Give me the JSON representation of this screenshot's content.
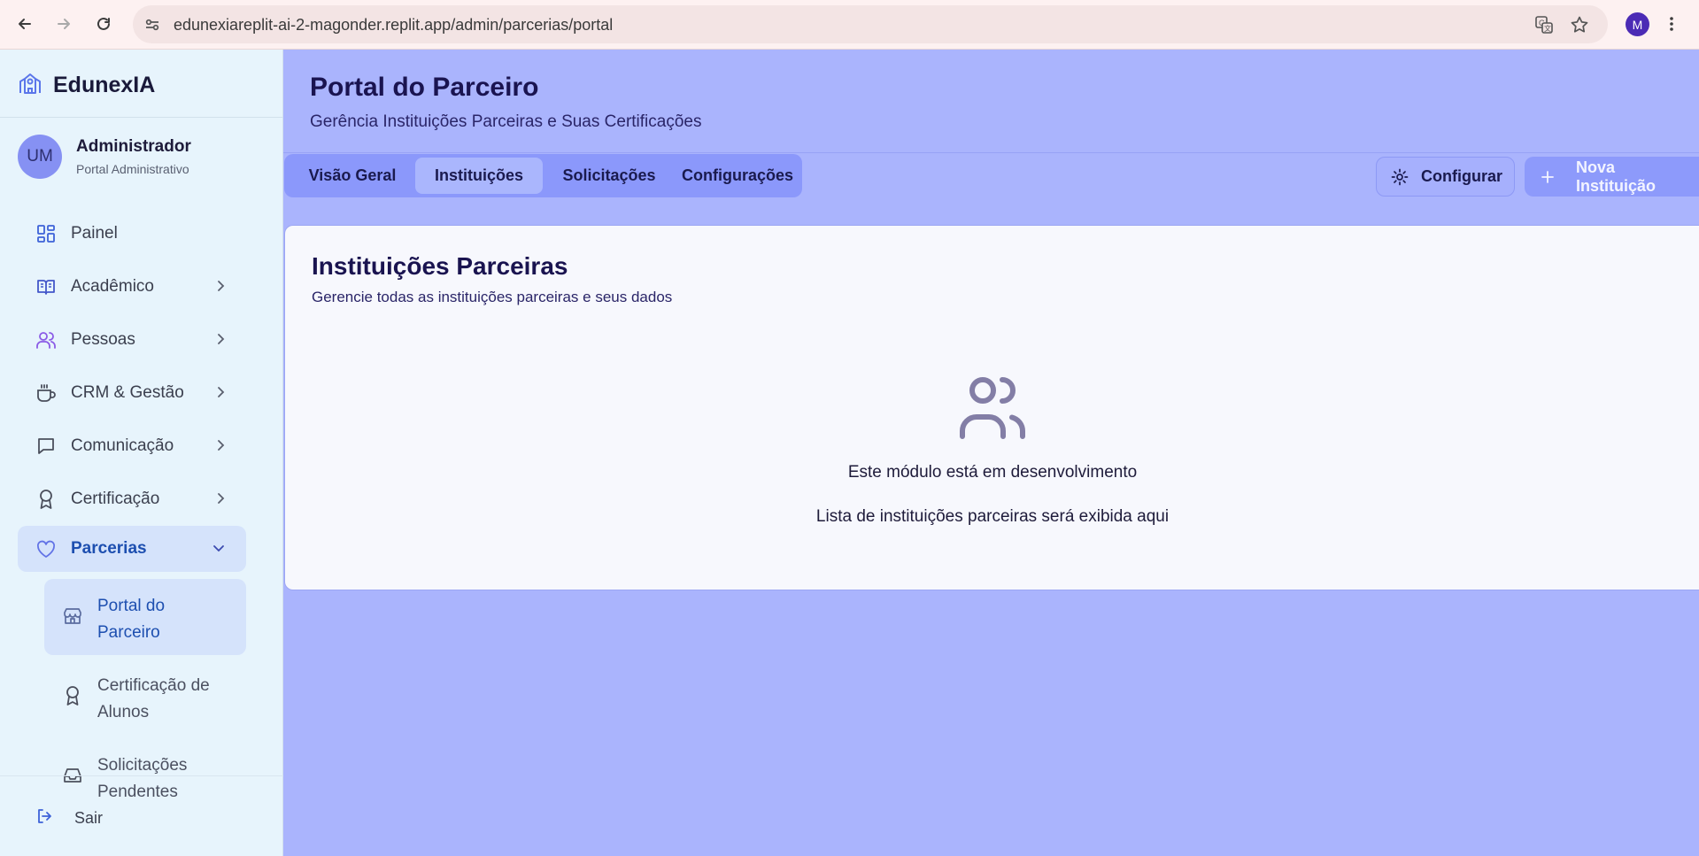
{
  "browser": {
    "url": "edunexiareplit-ai-2-magonder.replit.app/admin/parcerias/portal",
    "profile_initial": "M"
  },
  "sidebar": {
    "brand": "EdunexIA",
    "user": {
      "initials": "UM",
      "name": "Administrador",
      "role": "Portal Administrativo"
    },
    "items": [
      {
        "label": "Painel",
        "icon": "grid-icon"
      },
      {
        "label": "Acadêmico",
        "icon": "book-icon"
      },
      {
        "label": "Pessoas",
        "icon": "users-icon"
      },
      {
        "label": "CRM & Gestão",
        "icon": "coffee-icon"
      },
      {
        "label": "Comunicação",
        "icon": "message-icon"
      },
      {
        "label": "Certificação",
        "icon": "award-icon"
      },
      {
        "label": "Parcerias",
        "icon": "heart-icon"
      }
    ],
    "sub_items": [
      {
        "label": "Portal do Parceiro",
        "icon": "store-icon"
      },
      {
        "label": "Certificação de Alunos",
        "icon": "award-icon"
      },
      {
        "label": "Solicitações Pendentes",
        "icon": "inbox-icon"
      }
    ],
    "logout": "Sair"
  },
  "header": {
    "title": "Portal do Parceiro",
    "subtitle": "Gerência Instituições Parceiras e Suas Certificações"
  },
  "tabs": [
    "Visão Geral",
    "Instituições",
    "Solicitações",
    "Configurações"
  ],
  "actions": {
    "configure": "Configurar",
    "new_institution": "Nova Instituição"
  },
  "card": {
    "title": "Instituições Parceiras",
    "subtitle": "Gerencie todas as instituições parceiras e seus dados",
    "empty_message": "Este módulo está em desenvolvimento",
    "empty_detail": "Lista de instituições parceiras será exibida aqui"
  },
  "colors": {
    "accent": "#8b98fb",
    "background": "#aab4fd",
    "sidebar": "#e7f4fc",
    "active_text": "#1d4fb0"
  }
}
